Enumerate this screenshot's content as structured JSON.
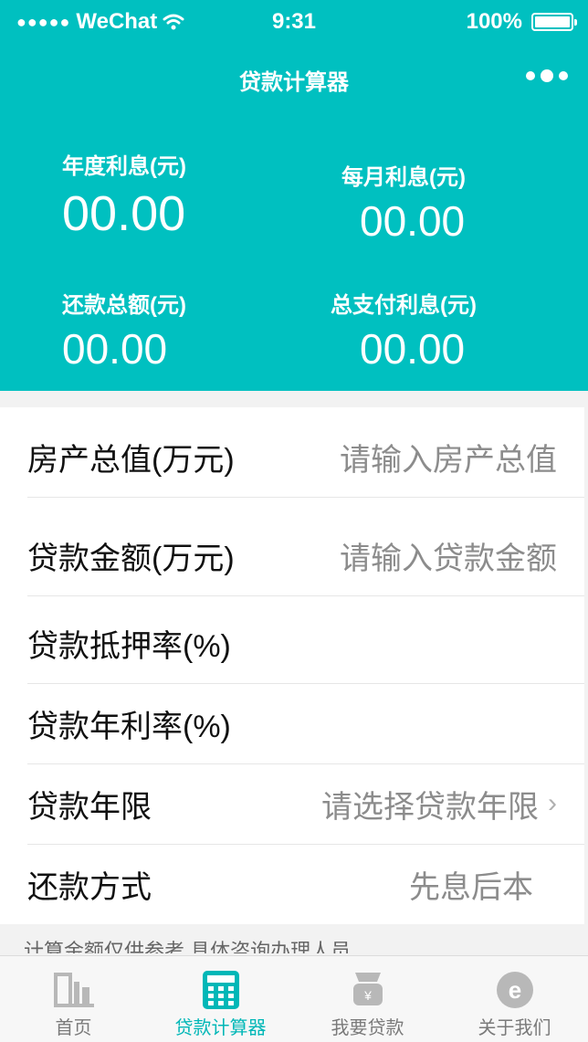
{
  "status_bar": {
    "carrier": "WeChat",
    "time": "9:31",
    "battery": "100%"
  },
  "nav": {
    "title": "贷款计算器"
  },
  "summary": [
    {
      "label": "年度利息(元)",
      "value": "00.00"
    },
    {
      "label": "每月利息(元)",
      "value": "00.00"
    },
    {
      "label": "还款总额(元)",
      "value": "00.00"
    },
    {
      "label": "总支付利息(元)",
      "value": "00.00"
    }
  ],
  "form": {
    "property_value": {
      "label": "房产总值(万元)",
      "placeholder": "请输入房产总值"
    },
    "loan_amount": {
      "label": "贷款金额(万元)",
      "placeholder": "请输入贷款金额"
    },
    "mortgage_rate": {
      "label": "贷款抵押率(%)",
      "value": ""
    },
    "annual_rate": {
      "label": "贷款年利率(%)",
      "value": ""
    },
    "loan_term": {
      "label": "贷款年限",
      "placeholder": "请选择贷款年限"
    },
    "repayment": {
      "label": "还款方式",
      "value": "先息后本"
    }
  },
  "note": "计算金额仅供参考,具体咨询办理人员",
  "tabs": [
    {
      "label": "首页",
      "icon": "home-building-icon",
      "active": false
    },
    {
      "label": "贷款计算器",
      "icon": "calculator-icon",
      "active": true
    },
    {
      "label": "我要贷款",
      "icon": "money-bag-icon",
      "active": false
    },
    {
      "label": "关于我们",
      "icon": "about-e-icon",
      "active": false
    }
  ],
  "colors": {
    "accent": "#00c0c0",
    "active_tab": "#00b7b7"
  }
}
